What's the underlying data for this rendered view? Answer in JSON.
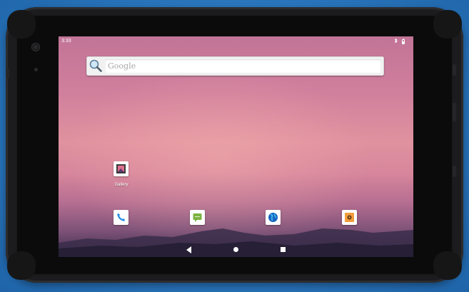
{
  "status_bar": {
    "time": "3:33",
    "icons": [
      "bluetooth-icon",
      "battery-icon"
    ]
  },
  "search": {
    "placeholder": "Google"
  },
  "desktop_apps": [
    {
      "label": "Gallery",
      "icon": "gallery-icon"
    }
  ],
  "dock_apps": [
    {
      "icon": "phone-icon",
      "color": "#1e88e5"
    },
    {
      "icon": "messages-icon",
      "color": "#7cb342"
    },
    {
      "icon": "browser-icon",
      "color": "#1565c0"
    },
    {
      "icon": "settings-icon",
      "color": "#f39c3c"
    }
  ],
  "nav_bar": {
    "buttons": [
      "back-icon",
      "home-icon",
      "recents-icon"
    ]
  },
  "colors": {
    "background": "#2f7fc4",
    "device_frame": "#1c1c1e",
    "wallpaper_top": "#c27497",
    "wallpaper_bottom": "#3b2c4c"
  }
}
